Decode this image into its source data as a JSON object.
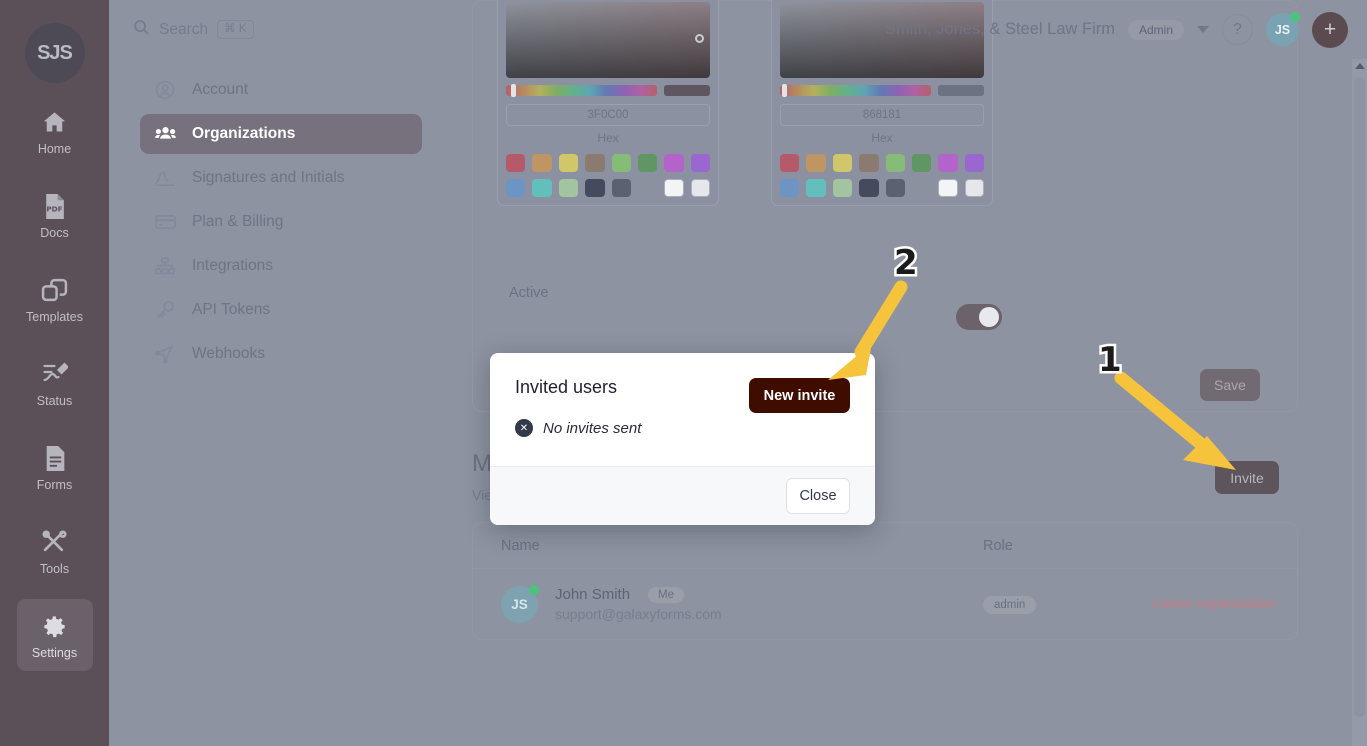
{
  "rail": {
    "logo_text": "SJS",
    "items": [
      {
        "label": "Home",
        "icon": "home-icon"
      },
      {
        "label": "Docs",
        "icon": "pdf-document-icon"
      },
      {
        "label": "Templates",
        "icon": "templates-copy-icon"
      },
      {
        "label": "Status",
        "icon": "signature-status-icon"
      },
      {
        "label": "Forms",
        "icon": "forms-list-icon"
      },
      {
        "label": "Tools",
        "icon": "tools-wrench-screwdriver-icon"
      },
      {
        "label": "Settings",
        "icon": "gear-icon"
      }
    ],
    "active": "Settings"
  },
  "topbar": {
    "search_placeholder": "Search",
    "search_shortcut": "⌘ K",
    "org_name": "Smith, Jones, & Steel Law Firm",
    "role_pill": "Admin",
    "help_glyph": "?",
    "avatar_initials": "JS",
    "plus_glyph": "+"
  },
  "settings_nav": {
    "items": [
      {
        "label": "Account",
        "icon": "user-circle-icon"
      },
      {
        "label": "Organizations",
        "icon": "people-group-icon"
      },
      {
        "label": "Signatures and Initials",
        "icon": "signature-pen-icon"
      },
      {
        "label": "Plan & Billing",
        "icon": "credit-card-icon"
      },
      {
        "label": "Integrations",
        "icon": "sitemap-icon"
      },
      {
        "label": "API Tokens",
        "icon": "key-icon"
      },
      {
        "label": "Webhooks",
        "icon": "webhook-share-icon"
      }
    ],
    "active": "Organizations"
  },
  "branding": {
    "pickers": [
      {
        "hex_value": "3F0C00",
        "hex_label": "Hex",
        "swatches": [
          "#b55a6b",
          "#bf9563",
          "#cfc76a",
          "#8b7a70",
          "#86bb78",
          "#5f9663",
          "#b364cb",
          "#9a66cf",
          "#6d95c4",
          "#62bfbb",
          "#a3c4a0",
          "#434b5c",
          "#596173",
          "#8b919e",
          "#f3f4f6",
          "#e5e7eb"
        ]
      },
      {
        "hex_value": "868181",
        "hex_label": "Hex",
        "swatches": [
          "#b55a6b",
          "#bf9563",
          "#cfc76a",
          "#8b7a70",
          "#86bb78",
          "#5f9663",
          "#b364cb",
          "#9a66cf",
          "#6d95c4",
          "#62bfbb",
          "#a3c4a0",
          "#434b5c",
          "#596173",
          "#8b919e",
          "#f3f4f6",
          "#e5e7eb"
        ]
      }
    ],
    "active_label": "Active",
    "active_on": true,
    "save_label": "Save"
  },
  "members": {
    "title": "Members",
    "subtitle": "View and manage the members of this organization.",
    "invite_label": "Invite",
    "columns": [
      "Name",
      "Role",
      ""
    ],
    "rows": [
      {
        "avatar_initials": "JS",
        "name": "John Smith",
        "me_badge": "Me",
        "email": "support@galaxyforms.com",
        "role": "admin",
        "action": "Leave organization"
      }
    ]
  },
  "modal": {
    "title": "Invited users",
    "new_invite_label": "New invite",
    "empty_state": "No invites sent",
    "empty_icon_glyph": "✕",
    "close_label": "Close"
  },
  "annotations": {
    "accent_color": "#F5C43C",
    "markers": [
      {
        "number": "1",
        "points_to": "Invite"
      },
      {
        "number": "2",
        "points_to": "New invite"
      }
    ]
  }
}
